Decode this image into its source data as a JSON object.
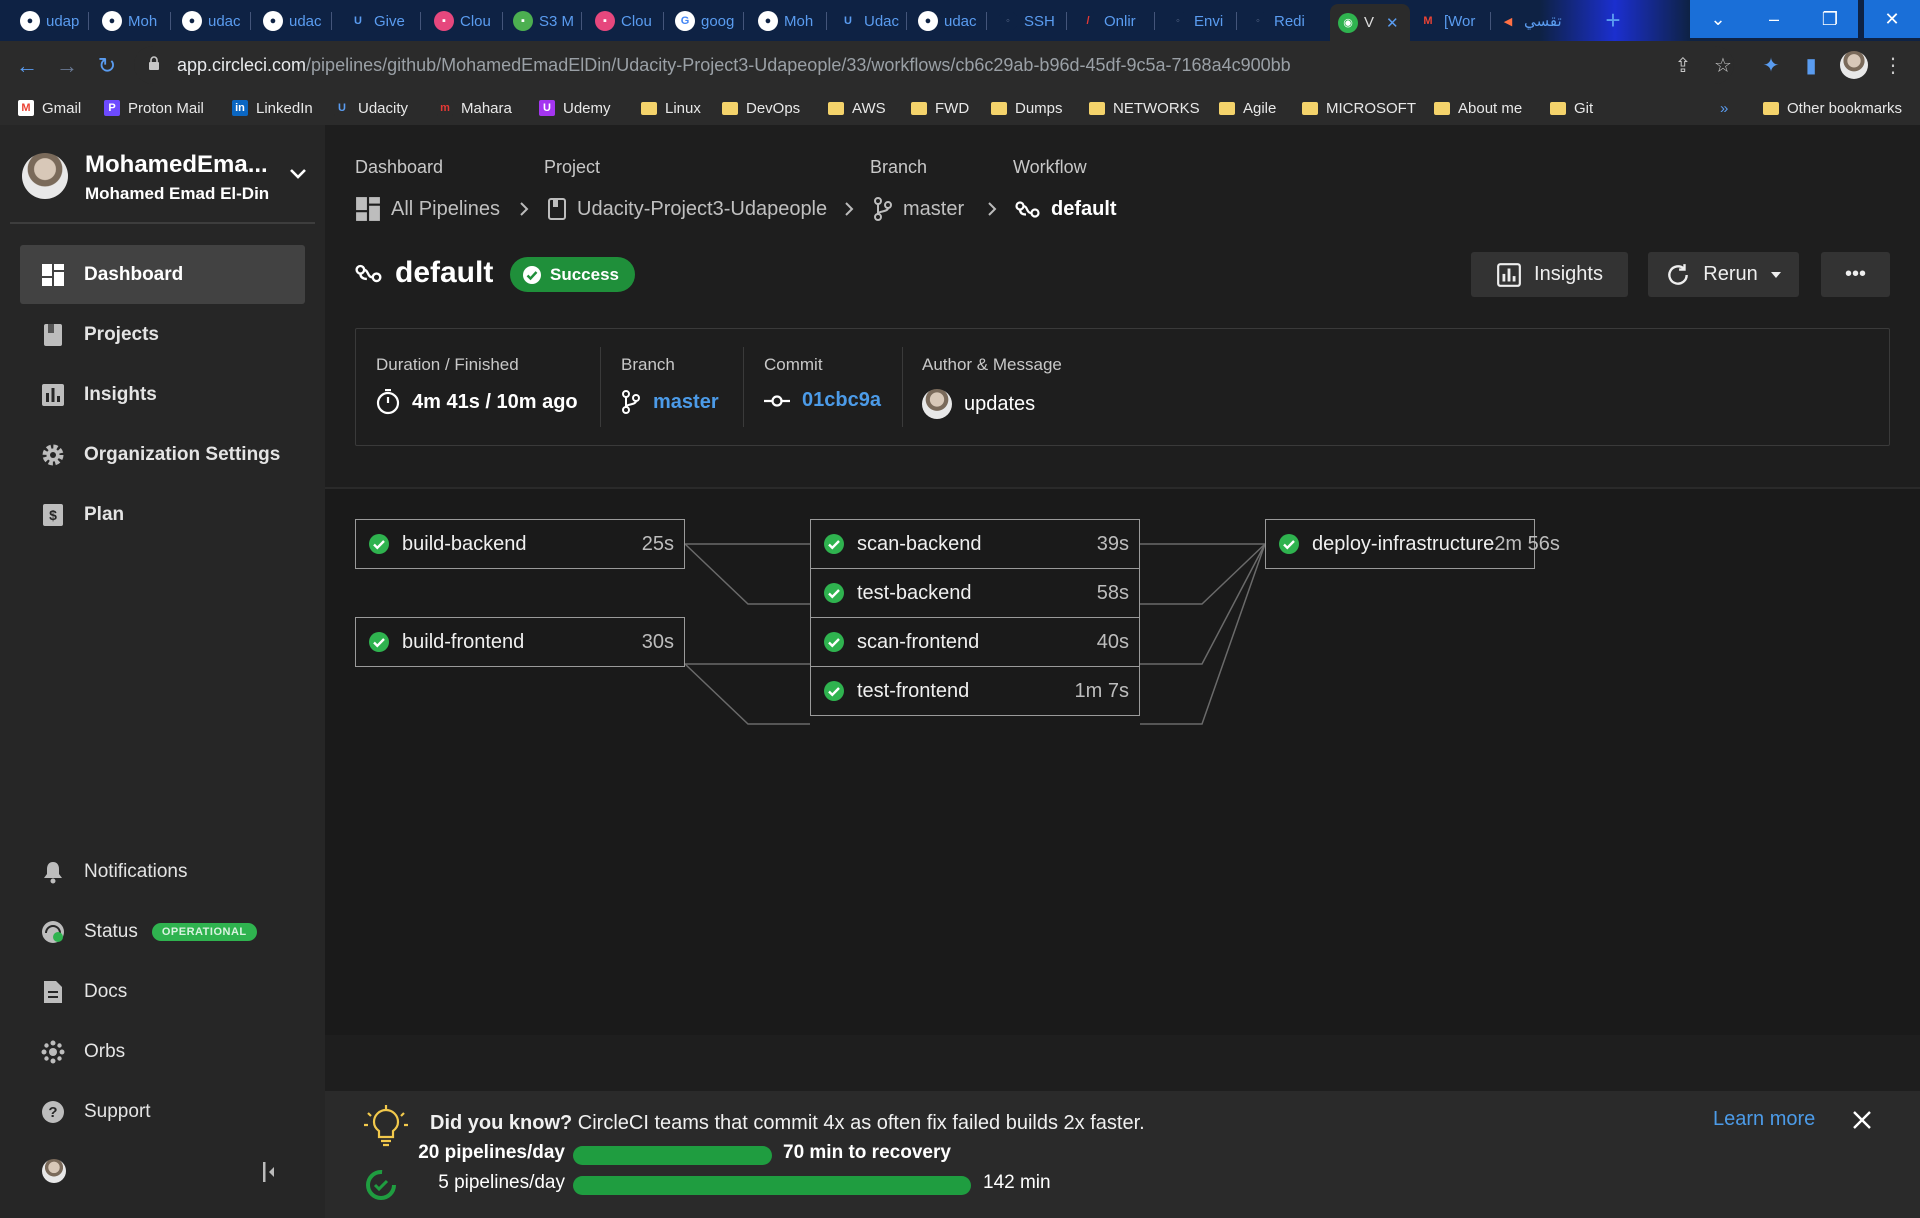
{
  "browser": {
    "tabs": [
      {
        "label": "udap",
        "icon": "github-icon"
      },
      {
        "label": "Moh",
        "icon": "github-icon"
      },
      {
        "label": "udac",
        "icon": "github-icon"
      },
      {
        "label": "udac",
        "icon": "github-icon"
      },
      {
        "label": "Give",
        "icon": "udacity-icon"
      },
      {
        "label": "Clou",
        "icon": "cloud-icon"
      },
      {
        "label": "S3 M",
        "icon": "s3-icon"
      },
      {
        "label": "Clou",
        "icon": "cloud-icon"
      },
      {
        "label": "goog",
        "icon": "google-icon"
      },
      {
        "label": "Moh",
        "icon": "github-icon"
      },
      {
        "label": "Udac",
        "icon": "udacity-icon"
      },
      {
        "label": "udac",
        "icon": "github-icon"
      },
      {
        "label": "SSH",
        "icon": "globe-icon"
      },
      {
        "label": "Onlir",
        "icon": "red-icon"
      },
      {
        "label": "Envi",
        "icon": "globe-icon"
      },
      {
        "label": "Redi",
        "icon": "globe-icon"
      },
      {
        "label": "V",
        "icon": "circleci-icon"
      },
      {
        "label": "[Wor",
        "icon": "gmail-icon"
      },
      {
        "label": "تقسي",
        "icon": "orange-icon"
      }
    ],
    "url_host": "app.circleci.com",
    "url_path": "/pipelines/github/MohamedEmadElDin/Udacity-Project3-Udapeople/33/workflows/cb6c29ab-b96d-45df-9c5a-7168a4c900bb",
    "bookmarks": [
      "Gmail",
      "Proton Mail",
      "LinkedIn",
      "Udacity",
      "Mahara",
      "Udemy",
      "Linux",
      "DevOps",
      "AWS",
      "FWD",
      "Dumps",
      "NETWORKS",
      "Agile",
      "MICROSOFT",
      "About me",
      "Git"
    ],
    "overflow": "»",
    "other_bookmarks": "Other bookmarks"
  },
  "sidebar": {
    "user_name": "MohamedEma...",
    "user_sub": "Mohamed Emad El-Din",
    "nav": [
      {
        "label": "Dashboard",
        "icon": "dashboard-icon"
      },
      {
        "label": "Projects",
        "icon": "projects-icon"
      },
      {
        "label": "Insights",
        "icon": "insights-icon"
      },
      {
        "label": "Organization Settings",
        "icon": "gear-icon"
      },
      {
        "label": "Plan",
        "icon": "plan-icon"
      }
    ],
    "bottom": [
      {
        "label": "Notifications",
        "icon": "bell-icon"
      },
      {
        "label": "Status",
        "icon": "status-icon"
      },
      {
        "label": "Docs",
        "icon": "docs-icon"
      },
      {
        "label": "Orbs",
        "icon": "orbs-icon"
      },
      {
        "label": "Support",
        "icon": "help-icon"
      }
    ],
    "status_badge": "OPERATIONAL"
  },
  "breadcrumb": {
    "dashboard_label": "Dashboard",
    "dashboard_value": "All Pipelines",
    "project_label": "Project",
    "project_value": "Udacity-Project3-Udapeople",
    "branch_label": "Branch",
    "branch_value": "master",
    "workflow_label": "Workflow",
    "workflow_value": "default"
  },
  "workflow": {
    "title": "default",
    "status": "Success",
    "insights_label": "Insights",
    "rerun_label": "Rerun",
    "more_label": "•••"
  },
  "info": {
    "duration_label": "Duration / Finished",
    "duration_value": "4m 41s / 10m ago",
    "branch_label": "Branch",
    "branch_value": "master",
    "commit_label": "Commit",
    "commit_value": "01cbc9a",
    "author_label": "Author & Message",
    "author_value": "updates"
  },
  "jobs": [
    {
      "name": "build-backend",
      "duration": "25s",
      "status": "success"
    },
    {
      "name": "build-frontend",
      "duration": "30s",
      "status": "success"
    },
    {
      "name": "scan-backend",
      "duration": "39s",
      "status": "success"
    },
    {
      "name": "test-backend",
      "duration": "58s",
      "status": "success"
    },
    {
      "name": "scan-frontend",
      "duration": "40s",
      "status": "success"
    },
    {
      "name": "test-frontend",
      "duration": "1m 7s",
      "status": "success"
    },
    {
      "name": "deploy-infrastructure",
      "duration": "2m 56s",
      "status": "success"
    }
  ],
  "tip": {
    "bold": "Did you know?",
    "text": "CircleCI teams that commit 4x as often fix failed builds 2x faster.",
    "learn_more": "Learn more",
    "row1_label": "20 pipelines/day",
    "row1_value": "70 min to recovery",
    "row2_label": "5 pipelines/day",
    "row2_value": "142 min"
  },
  "colors": {
    "success": "#1f8f3a",
    "link": "#4c9be8",
    "sidebar_bg": "#262626",
    "main_bg": "#1e1e1e"
  }
}
